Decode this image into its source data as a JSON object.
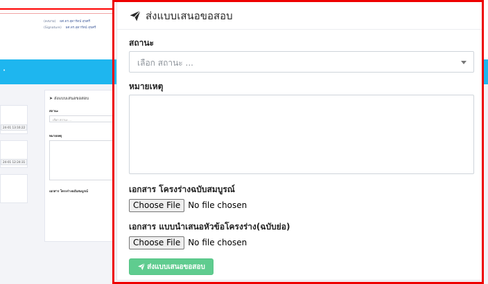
{
  "background": {
    "signature_lines": [
      {
        "label": "(ลงนาม)",
        "value": "ผศ.ดร.สุดารัตน์ สุขศรี"
      },
      {
        "label": "(Signature)",
        "value": "ผศ.ดร.สุดารัตน์ สุขศรี"
      }
    ],
    "mini_panel": {
      "title": "ส่งแบบเสนอขอสอบ",
      "status_label": "สถานะ",
      "status_placeholder": "เลือก สถานะ ...",
      "note_label": "หมายเหตุ",
      "document_label": "เอกสาร โครงร่างฉบับสมบูรณ์"
    },
    "timestamps": [
      "24-01 13:16:22",
      "24-01 12:24:31"
    ]
  },
  "panel": {
    "title": "ส่งแบบเสนอขอสอบ",
    "title_icon": "paper-plane-icon",
    "status": {
      "label": "สถานะ",
      "placeholder": "เลือก สถานะ ...",
      "value": ""
    },
    "note": {
      "label": "หมายเหตุ",
      "value": ""
    },
    "file_full_outline": {
      "label": "เอกสาร โครงร่างฉบับสมบูรณ์",
      "button_label": "Choose File",
      "status": "No file chosen"
    },
    "file_summary_outline": {
      "label": "เอกสาร แบบนำเสนอหัวข้อโครงร่าง(ฉบับย่อ)",
      "button_label": "Choose File",
      "status": "No file chosen"
    },
    "submit": {
      "label": "ส่งแบบเสนอขอสอบ",
      "icon": "paper-plane-icon",
      "color": "#5fcc8f"
    }
  },
  "colors": {
    "highlight": "#ee0000",
    "header_band": "#1eb6ef"
  }
}
